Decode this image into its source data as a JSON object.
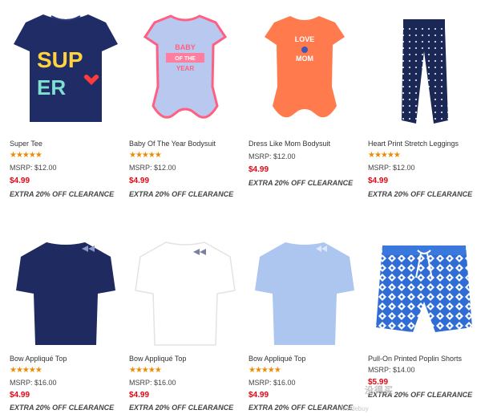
{
  "products": [
    {
      "name": "Super Tee",
      "rating": "★★★★★",
      "msrp": "MSRP: $12.00",
      "price": "$4.99",
      "promo": "EXTRA 20% OFF CLEARANCE",
      "image": "navy-super-tee",
      "colors": {
        "main": "#1f2c66"
      }
    },
    {
      "name": "Baby Of The Year Bodysuit",
      "rating": "★★★★★",
      "msrp": "MSRP: $12.00",
      "price": "$4.99",
      "promo": "EXTRA 20% OFF CLEARANCE",
      "image": "light-blue-bodysuit",
      "colors": {
        "main": "#b9c8ef",
        "trim": "#ff5f82"
      }
    },
    {
      "name": "Dress Like Mom Bodysuit",
      "rating": "",
      "msrp": "MSRP: $12.00",
      "price": "$4.99",
      "promo": "EXTRA 20% OFF CLEARANCE",
      "image": "orange-bodysuit",
      "colors": {
        "main": "#ff7a4c"
      }
    },
    {
      "name": "Heart Print Stretch Leggings",
      "rating": "★★★★★",
      "msrp": "MSRP: $12.00",
      "price": "$4.99",
      "promo": "EXTRA 20% OFF CLEARANCE",
      "image": "navy-leggings",
      "colors": {
        "main": "#1b2754"
      }
    },
    {
      "name": "Bow Appliqué Top",
      "rating": "★★★★★",
      "msrp": "MSRP: $16.00",
      "price": "$4.99",
      "promo": "EXTRA 20% OFF CLEARANCE",
      "image": "navy-bow-top",
      "colors": {
        "main": "#1f2a60"
      }
    },
    {
      "name": "Bow Appliqué Top",
      "rating": "★★★★★",
      "msrp": "MSRP: $16.00",
      "price": "$4.99",
      "promo": "EXTRA 20% OFF CLEARANCE",
      "image": "white-bow-top",
      "colors": {
        "main": "#ffffff"
      }
    },
    {
      "name": "Bow Appliqué Top",
      "rating": "★★★★★",
      "msrp": "MSRP: $16.00",
      "price": "$4.99",
      "promo": "EXTRA 20% OFF CLEARANCE",
      "image": "light-blue-bow-top",
      "colors": {
        "main": "#acc6f0"
      }
    },
    {
      "name": "Pull-On Printed Poplin Shorts",
      "rating": "",
      "msrp": "MSRP: $14.00",
      "price": "$5.99",
      "promo": "EXTRA 20% OFF CLEARANCE",
      "image": "blue-print-shorts",
      "colors": {
        "main": "#2f6cd3"
      }
    }
  ],
  "image_text": {
    "super_top": "SUP",
    "super_bottom": "ER",
    "bodysuit_line1": "BABY",
    "bodysuit_line2": "OF THE",
    "bodysuit_line3": "YEAR",
    "mom_line1": "LOVE",
    "mom_line2": "MOM"
  },
  "watermark": {
    "line1": "没得买",
    "line2": "Meidebuy"
  }
}
